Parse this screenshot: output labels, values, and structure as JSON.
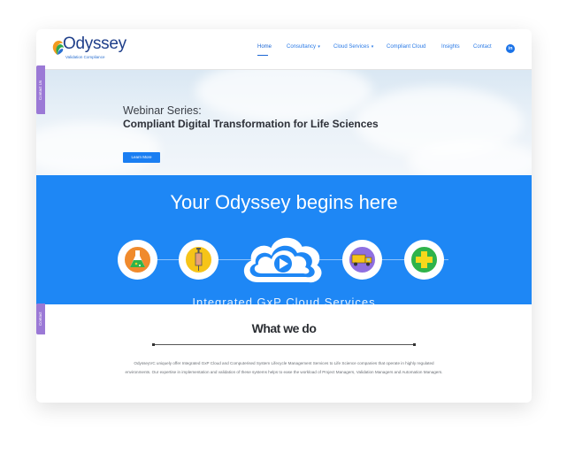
{
  "brand": {
    "name": "Odyssey",
    "tagline": "Validation Compliance"
  },
  "nav": {
    "items": [
      {
        "label": "Home",
        "active": true
      },
      {
        "label": "Consultancy",
        "dropdown": true
      },
      {
        "label": "Cloud Services",
        "dropdown": true
      },
      {
        "label": "Compliant Cloud"
      },
      {
        "label": "Insights"
      },
      {
        "label": "Contact"
      }
    ],
    "social_icon": "linkedin-icon",
    "social_label": "in"
  },
  "hero": {
    "kicker": "Webinar Series:",
    "title": "Compliant Digital Transformation for Life Sciences",
    "button_label": "Learn More"
  },
  "band": {
    "title": "Your Odyssey begins here",
    "subtitle": "Integrated GxP Cloud Services",
    "icons": [
      "lab-flask-icon",
      "syringe-icon",
      "play-cloud-icon",
      "truck-icon",
      "plus-icon"
    ]
  },
  "what_we_do": {
    "title": "What we do",
    "body": "OdysseyVC uniquely offer Integrated GxP Cloud and Computerised System Lifecycle Management Services to Life Science companies that operate in highly regulated environments. Our expertise in implementation and validation of these systems helps to ease the workload of Project Managers, Validation Managers and Automation Managers."
  },
  "side_tabs": [
    "Contact Us",
    "Contact"
  ],
  "colors": {
    "brand_blue": "#1e87f5",
    "nav_blue": "#2a7ae6",
    "side_tab_purple": "#9b79d6"
  }
}
